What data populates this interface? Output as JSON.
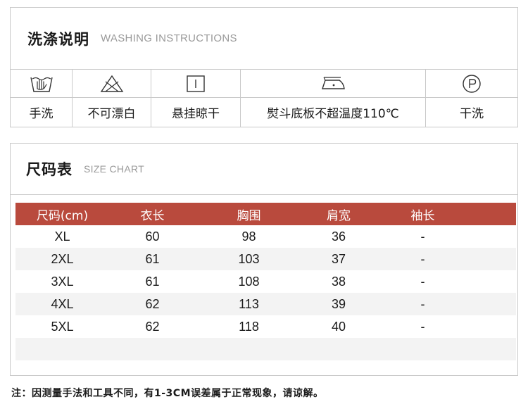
{
  "washing": {
    "title_cn": "洗涤说明",
    "title_en": "WASHING INSTRUCTIONS",
    "items": [
      {
        "icon": "hand-wash-icon",
        "label": "手洗"
      },
      {
        "icon": "no-bleach-icon",
        "label": "不可漂白"
      },
      {
        "icon": "line-dry-icon",
        "label": "悬挂晾干"
      },
      {
        "icon": "iron-icon",
        "label": "熨斗底板不超温度110℃"
      },
      {
        "icon": "dry-clean-icon",
        "label": "干洗"
      }
    ]
  },
  "size_chart": {
    "title_cn": "尺码表",
    "title_en": "SIZE CHART",
    "header_color": "#b94a3d",
    "headers": [
      "尺码(cm)",
      "衣长",
      "胸围",
      "肩宽",
      "袖长"
    ],
    "rows": [
      [
        "XL",
        "60",
        "98",
        "36",
        "-"
      ],
      [
        "2XL",
        "61",
        "103",
        "37",
        "-"
      ],
      [
        "3XL",
        "61",
        "108",
        "38",
        "-"
      ],
      [
        "4XL",
        "62",
        "113",
        "39",
        "-"
      ],
      [
        "5XL",
        "62",
        "118",
        "40",
        "-"
      ]
    ]
  },
  "note": "注：因测量手法和工具不同，有1-3CM误差属于正常现象，请谅解。"
}
